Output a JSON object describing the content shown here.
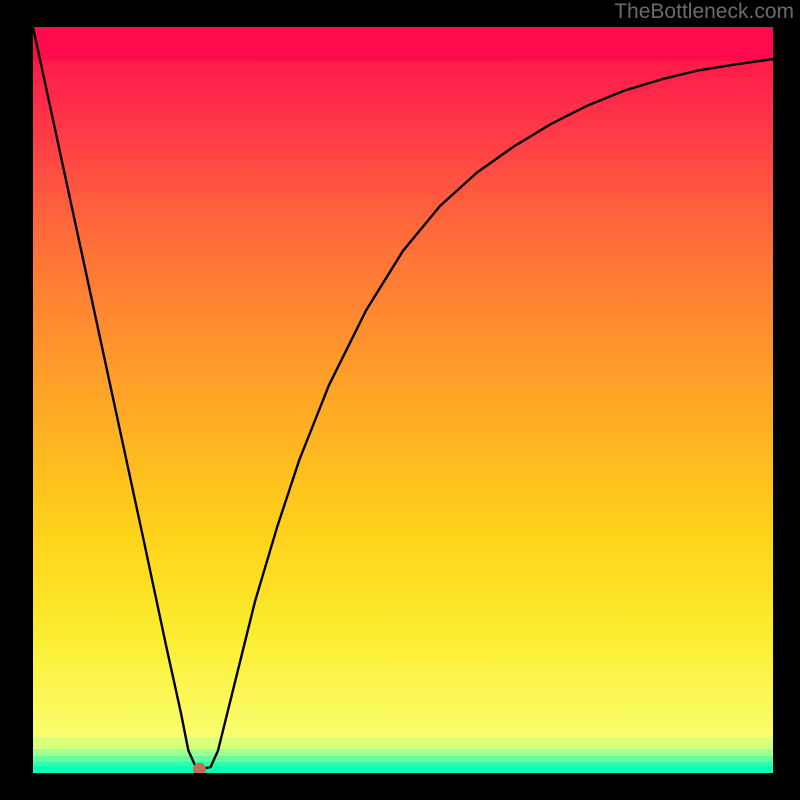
{
  "watermark": "TheBottleneck.com",
  "chart_data": {
    "type": "line",
    "title": "",
    "xlabel": "",
    "ylabel": "",
    "xlim": [
      0,
      100
    ],
    "ylim": [
      0,
      100
    ],
    "grid": false,
    "legend": false,
    "x": [
      0,
      5,
      10,
      15,
      18,
      19,
      20,
      21,
      22,
      23,
      24,
      25,
      27,
      30,
      33,
      36,
      40,
      45,
      50,
      55,
      60,
      65,
      70,
      75,
      80,
      85,
      90,
      95,
      100
    ],
    "y": [
      100,
      77,
      54,
      31,
      17,
      12.5,
      8,
      3,
      0.8,
      0.6,
      0.8,
      3,
      11,
      23,
      33,
      42,
      52,
      62,
      70,
      76,
      80.5,
      84,
      87,
      89.5,
      91.5,
      93,
      94.2,
      95,
      95.7
    ],
    "marker": {
      "x": 22.5,
      "y": 0.5,
      "color": "#c76b5b"
    },
    "background_bands": [
      {
        "y0": 100,
        "y1": 95.5,
        "color": "#ff0a4d"
      },
      {
        "y0": 95.5,
        "y1": 4.8,
        "type": "gradient",
        "from": "#ff1a4b",
        "via": "#ffd31a",
        "to": "#faff70"
      },
      {
        "y0": 4.8,
        "y1": 3.2,
        "color": "#d7ff7a"
      },
      {
        "y0": 3.2,
        "y1": 2.3,
        "color": "#9fff93"
      },
      {
        "y0": 2.3,
        "y1": 1.5,
        "color": "#5fffa2"
      },
      {
        "y0": 1.5,
        "y1": 0.9,
        "color": "#2dffb0"
      },
      {
        "y0": 0.9,
        "y1": 0.0,
        "color": "#07ffb6"
      }
    ]
  }
}
